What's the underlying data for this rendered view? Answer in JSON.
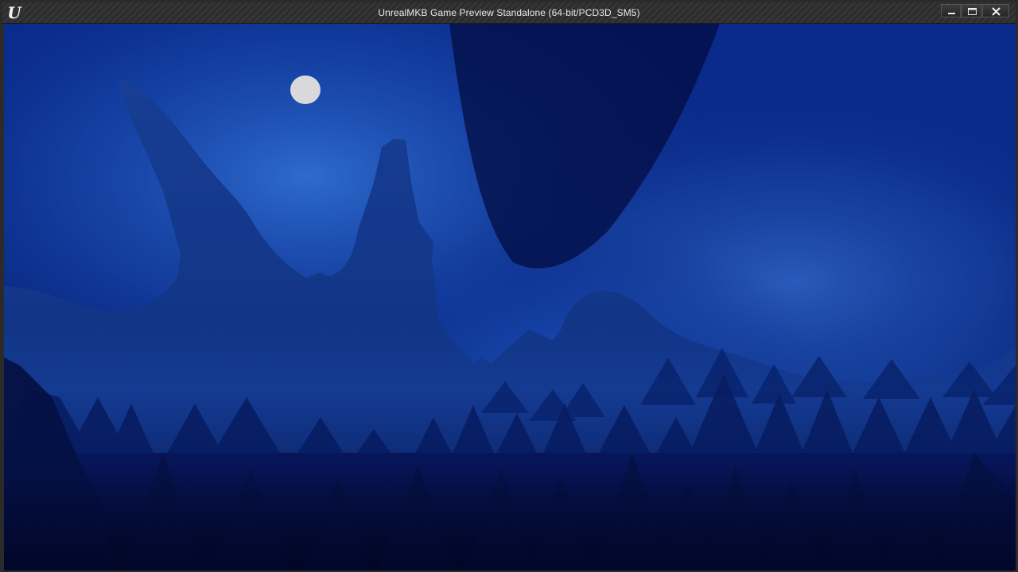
{
  "window": {
    "title": "UnrealMKB Game Preview Standalone (64-bit/PCD3D_SM5)",
    "logo_glyph": "U",
    "logo_icon": "unreal-engine-logo-icon",
    "controls": [
      {
        "name": "minimize",
        "icon": "minimize-icon"
      },
      {
        "name": "maximize",
        "icon": "maximize-icon"
      },
      {
        "name": "close",
        "icon": "close-icon"
      }
    ]
  },
  "scene": {
    "description_type": "night-landscape",
    "colors": {
      "sky_bright": "#2f66c8",
      "sky_dark": "#030a3a",
      "moon": "#d9d9dc",
      "mountain_far": "#10307e",
      "hills_mid": "#0c2468",
      "forest_dark": "#051248",
      "foreground": "#020a30"
    }
  }
}
